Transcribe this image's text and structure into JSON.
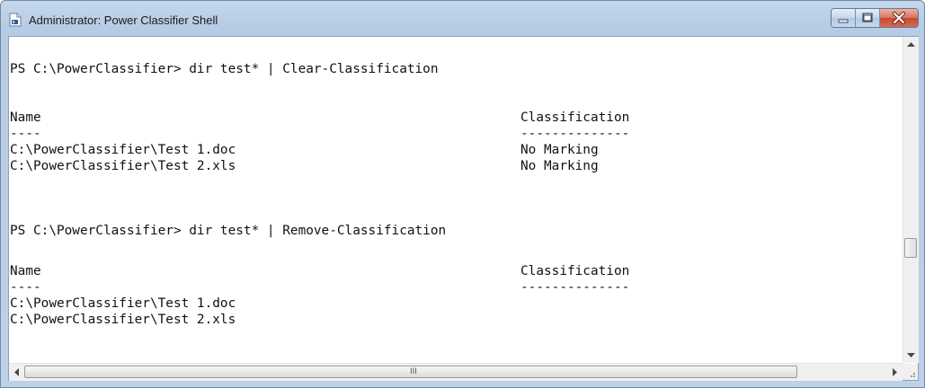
{
  "window": {
    "title": "Administrator: Power Classifier Shell"
  },
  "caption_buttons": [
    "minimize",
    "maximize",
    "close"
  ],
  "console": {
    "block1": {
      "prompt": "PS C:\\PowerClassifier> dir test* | Clear-Classification",
      "header": {
        "name": "Name",
        "classification": "Classification"
      },
      "separator": {
        "name": "----",
        "classification": "--------------"
      },
      "rows": [
        {
          "name": "C:\\PowerClassifier\\Test 1.doc",
          "classification": "No Marking"
        },
        {
          "name": "C:\\PowerClassifier\\Test 2.xls",
          "classification": "No Marking"
        }
      ]
    },
    "block2": {
      "prompt": "PS C:\\PowerClassifier> dir test* | Remove-Classification",
      "header": {
        "name": "Name",
        "classification": "Classification"
      },
      "separator": {
        "name": "----",
        "classification": "--------------"
      },
      "rows": [
        {
          "name": "C:\\PowerClassifier\\Test 1.doc",
          "classification": ""
        },
        {
          "name": "C:\\PowerClassifier\\Test 2.xls",
          "classification": ""
        }
      ]
    }
  },
  "scrollbar": {
    "horizontal_thumb_grip": "III"
  },
  "icons": {
    "app": "powershell-window-icon",
    "minimize": "minimize-icon",
    "maximize": "maximize-icon",
    "close": "close-icon",
    "scroll_up": "arrow-up-icon",
    "scroll_down": "arrow-down-icon",
    "scroll_left": "arrow-left-icon",
    "scroll_right": "arrow-right-icon"
  },
  "colors": {
    "console_background": "#ffffff",
    "console_text": "#111111",
    "close_button": "#c9503a",
    "frame": "#bdd1e8"
  }
}
